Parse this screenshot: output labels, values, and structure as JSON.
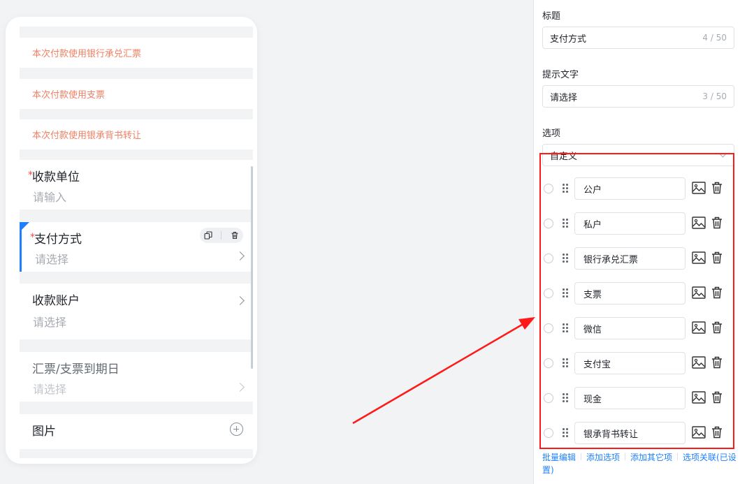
{
  "preview": {
    "tips": [
      {
        "text": "本次付款使用银行承兑汇票"
      },
      {
        "text": "本次付款使用支票"
      },
      {
        "text": "本次付款使用银承背书转让"
      }
    ],
    "fields": [
      {
        "label": "收款单位",
        "required_mark": "*",
        "placeholder": "请输入"
      },
      {
        "label": "支付方式",
        "required_mark": "*",
        "placeholder": "请选择"
      },
      {
        "label": "收款账户",
        "placeholder": "请选择"
      },
      {
        "label": "汇票/支票到期日",
        "placeholder": "请选择"
      },
      {
        "label": "图片"
      }
    ]
  },
  "settings": {
    "title_label": "标题",
    "title_value": "支付方式",
    "title_count": "4 / 50",
    "hint_label": "提示文字",
    "hint_value": "请选择",
    "hint_count": "3 / 50",
    "options_label": "选项",
    "options_mode": "自定义",
    "options": [
      {
        "label": "公户"
      },
      {
        "label": "私户"
      },
      {
        "label": "银行承兑汇票"
      },
      {
        "label": "支票"
      },
      {
        "label": "微信"
      },
      {
        "label": "支付宝"
      },
      {
        "label": "现金"
      },
      {
        "label": "银承背书转让"
      }
    ],
    "links": {
      "batch_edit": "批量编辑",
      "add_option": "添加选项",
      "add_other": "添加其它项",
      "option_link": "选项关联(已设置)"
    }
  },
  "colors": {
    "accent": "#1e80ff",
    "tip_text": "#f07f63",
    "required": "#f54a45",
    "annotation": "#ff1a1a"
  }
}
